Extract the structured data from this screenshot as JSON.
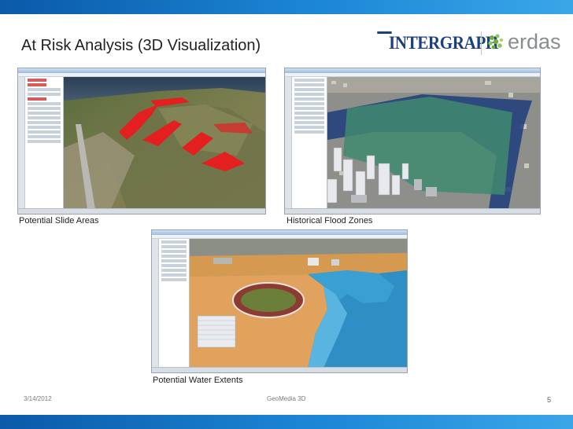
{
  "slide": {
    "title": "At Risk Analysis (3D Visualization)",
    "page_number": "5",
    "date": "3/14/2012",
    "footer_center": "GeoMedia 3D"
  },
  "logos": {
    "intergraph": "INTERGRAPH",
    "erdas": "erdas"
  },
  "screenshots": [
    {
      "caption": "Potential Slide Areas"
    },
    {
      "caption": "Historical Flood Zones"
    },
    {
      "caption": "Potential Water Extents"
    }
  ],
  "colors": {
    "brand_blue": "#1c86d6",
    "intergraph_navy": "#1c3f7e",
    "erdas_gray": "#8a8d8f",
    "erdas_green": "#6fae3b",
    "slide_highlight": "#e41f1f",
    "flood_zone": "#3f8a6f",
    "water": "#2f8fc4"
  }
}
